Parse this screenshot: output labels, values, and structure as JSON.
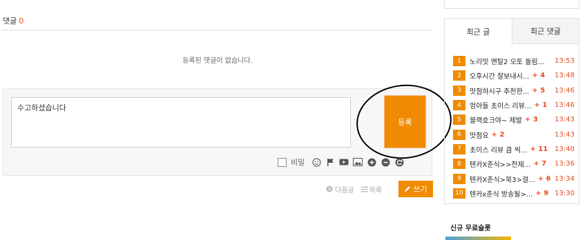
{
  "comments": {
    "label": "댓글",
    "count": "0",
    "empty_message": "등록된 댓글이 없습니다.",
    "input_value": "수고하셨습니다",
    "submit_label": "등록",
    "secret_label": "비밀",
    "tool_icons": [
      "smile-icon",
      "flag-icon",
      "video-icon",
      "image-icon",
      "plus-circle-icon",
      "minus-circle-icon",
      "refresh-icon"
    ]
  },
  "post_nav": {
    "next_label": "다음글",
    "list_label": "목록",
    "write_label": "쓰기"
  },
  "sidebar": {
    "tabs": [
      {
        "label": "최근 글",
        "active": true
      },
      {
        "label": "최근 댓글",
        "active": false
      }
    ],
    "recent_posts": [
      {
        "rank": "1",
        "title": "노리밋 멘탈2 오토 돌림...",
        "comments": "",
        "time": "13:53"
      },
      {
        "rank": "2",
        "title": "오후시간 잘보내시...",
        "comments": "+ 4",
        "time": "13:48"
      },
      {
        "rank": "3",
        "title": "맛점하시구 추천한...",
        "comments": "+ 5",
        "time": "13:46"
      },
      {
        "rank": "4",
        "title": "엉아들 초이스 리뷰...",
        "comments": "+ 1",
        "time": "13:46"
      },
      {
        "rank": "5",
        "title": "블랙호크야~ 제발",
        "comments": "+ 3",
        "time": "13:43"
      },
      {
        "rank": "6",
        "title": "맛점요",
        "comments": "+ 2",
        "time": "13:43"
      },
      {
        "rank": "7",
        "title": "초이스 리뷰 큼 씩...",
        "comments": "+ 11",
        "time": "13:40"
      },
      {
        "rank": "8",
        "title": "텐카X춘식>>전제...",
        "comments": "+ 7",
        "time": "13:36"
      },
      {
        "rank": "9",
        "title": "텐카X춘식>북3>걸...",
        "comments": "+ 6",
        "time": "13:34"
      },
      {
        "rank": "10",
        "title": "텐카x춘식 방송될>...",
        "comments": "+ 9",
        "time": "13:30"
      }
    ],
    "new_slots_title": "신규 무료슬롯"
  }
}
